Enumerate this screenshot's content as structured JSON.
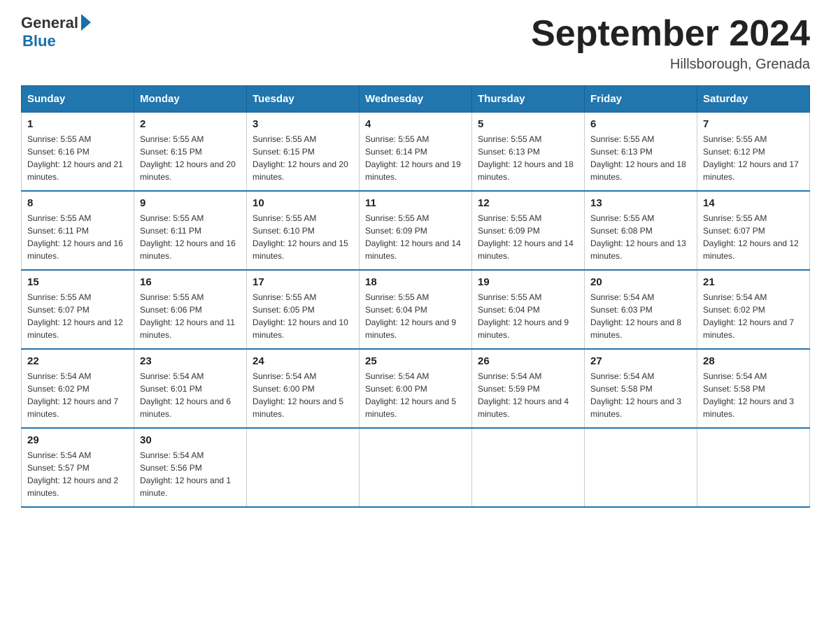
{
  "header": {
    "logo_general": "General",
    "logo_blue": "Blue",
    "month_title": "September 2024",
    "location": "Hillsborough, Grenada"
  },
  "weekdays": [
    "Sunday",
    "Monday",
    "Tuesday",
    "Wednesday",
    "Thursday",
    "Friday",
    "Saturday"
  ],
  "weeks": [
    [
      {
        "day": "1",
        "sunrise": "5:55 AM",
        "sunset": "6:16 PM",
        "daylight": "12 hours and 21 minutes."
      },
      {
        "day": "2",
        "sunrise": "5:55 AM",
        "sunset": "6:15 PM",
        "daylight": "12 hours and 20 minutes."
      },
      {
        "day": "3",
        "sunrise": "5:55 AM",
        "sunset": "6:15 PM",
        "daylight": "12 hours and 20 minutes."
      },
      {
        "day": "4",
        "sunrise": "5:55 AM",
        "sunset": "6:14 PM",
        "daylight": "12 hours and 19 minutes."
      },
      {
        "day": "5",
        "sunrise": "5:55 AM",
        "sunset": "6:13 PM",
        "daylight": "12 hours and 18 minutes."
      },
      {
        "day": "6",
        "sunrise": "5:55 AM",
        "sunset": "6:13 PM",
        "daylight": "12 hours and 18 minutes."
      },
      {
        "day": "7",
        "sunrise": "5:55 AM",
        "sunset": "6:12 PM",
        "daylight": "12 hours and 17 minutes."
      }
    ],
    [
      {
        "day": "8",
        "sunrise": "5:55 AM",
        "sunset": "6:11 PM",
        "daylight": "12 hours and 16 minutes."
      },
      {
        "day": "9",
        "sunrise": "5:55 AM",
        "sunset": "6:11 PM",
        "daylight": "12 hours and 16 minutes."
      },
      {
        "day": "10",
        "sunrise": "5:55 AM",
        "sunset": "6:10 PM",
        "daylight": "12 hours and 15 minutes."
      },
      {
        "day": "11",
        "sunrise": "5:55 AM",
        "sunset": "6:09 PM",
        "daylight": "12 hours and 14 minutes."
      },
      {
        "day": "12",
        "sunrise": "5:55 AM",
        "sunset": "6:09 PM",
        "daylight": "12 hours and 14 minutes."
      },
      {
        "day": "13",
        "sunrise": "5:55 AM",
        "sunset": "6:08 PM",
        "daylight": "12 hours and 13 minutes."
      },
      {
        "day": "14",
        "sunrise": "5:55 AM",
        "sunset": "6:07 PM",
        "daylight": "12 hours and 12 minutes."
      }
    ],
    [
      {
        "day": "15",
        "sunrise": "5:55 AM",
        "sunset": "6:07 PM",
        "daylight": "12 hours and 12 minutes."
      },
      {
        "day": "16",
        "sunrise": "5:55 AM",
        "sunset": "6:06 PM",
        "daylight": "12 hours and 11 minutes."
      },
      {
        "day": "17",
        "sunrise": "5:55 AM",
        "sunset": "6:05 PM",
        "daylight": "12 hours and 10 minutes."
      },
      {
        "day": "18",
        "sunrise": "5:55 AM",
        "sunset": "6:04 PM",
        "daylight": "12 hours and 9 minutes."
      },
      {
        "day": "19",
        "sunrise": "5:55 AM",
        "sunset": "6:04 PM",
        "daylight": "12 hours and 9 minutes."
      },
      {
        "day": "20",
        "sunrise": "5:54 AM",
        "sunset": "6:03 PM",
        "daylight": "12 hours and 8 minutes."
      },
      {
        "day": "21",
        "sunrise": "5:54 AM",
        "sunset": "6:02 PM",
        "daylight": "12 hours and 7 minutes."
      }
    ],
    [
      {
        "day": "22",
        "sunrise": "5:54 AM",
        "sunset": "6:02 PM",
        "daylight": "12 hours and 7 minutes."
      },
      {
        "day": "23",
        "sunrise": "5:54 AM",
        "sunset": "6:01 PM",
        "daylight": "12 hours and 6 minutes."
      },
      {
        "day": "24",
        "sunrise": "5:54 AM",
        "sunset": "6:00 PM",
        "daylight": "12 hours and 5 minutes."
      },
      {
        "day": "25",
        "sunrise": "5:54 AM",
        "sunset": "6:00 PM",
        "daylight": "12 hours and 5 minutes."
      },
      {
        "day": "26",
        "sunrise": "5:54 AM",
        "sunset": "5:59 PM",
        "daylight": "12 hours and 4 minutes."
      },
      {
        "day": "27",
        "sunrise": "5:54 AM",
        "sunset": "5:58 PM",
        "daylight": "12 hours and 3 minutes."
      },
      {
        "day": "28",
        "sunrise": "5:54 AM",
        "sunset": "5:58 PM",
        "daylight": "12 hours and 3 minutes."
      }
    ],
    [
      {
        "day": "29",
        "sunrise": "5:54 AM",
        "sunset": "5:57 PM",
        "daylight": "12 hours and 2 minutes."
      },
      {
        "day": "30",
        "sunrise": "5:54 AM",
        "sunset": "5:56 PM",
        "daylight": "12 hours and 1 minute."
      },
      null,
      null,
      null,
      null,
      null
    ]
  ]
}
